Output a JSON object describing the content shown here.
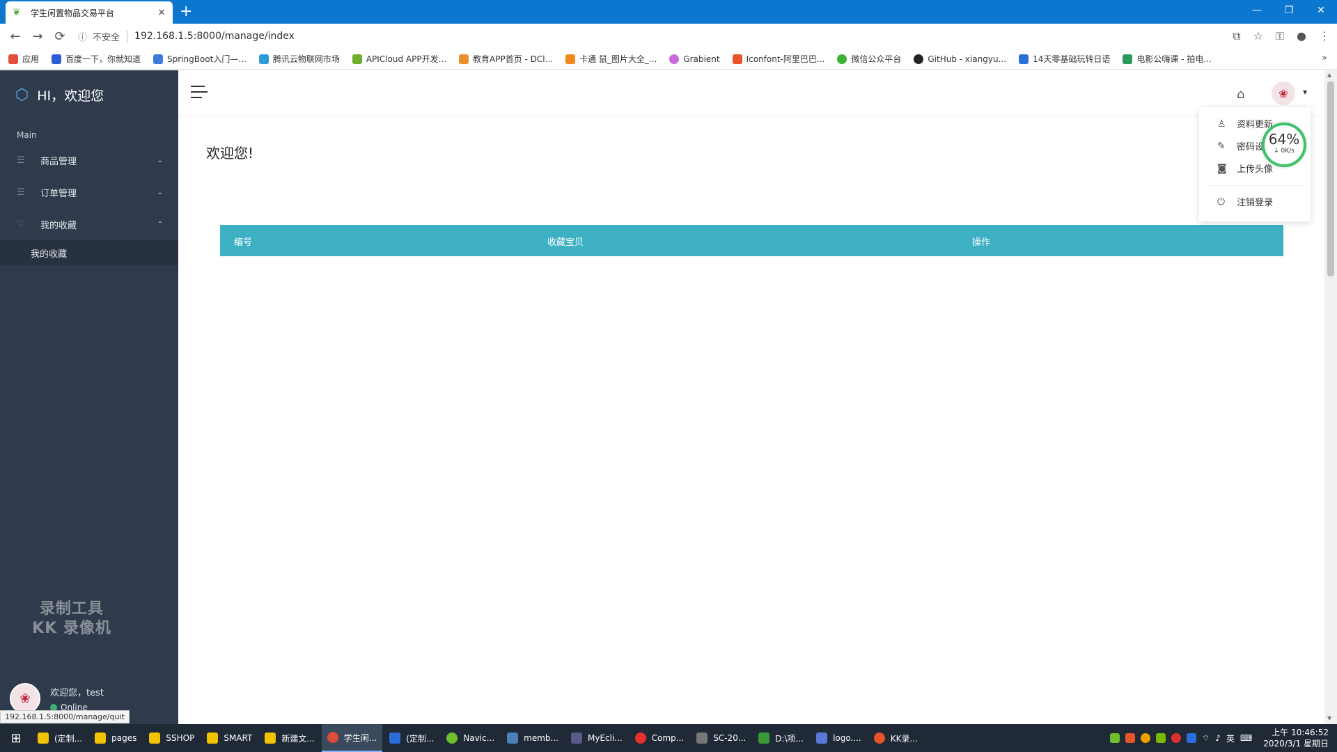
{
  "browser": {
    "tab_title": "学生闲置物品交易平台",
    "tab_close": "×",
    "new_tab": "+",
    "window_controls": {
      "minimize": "—",
      "restore": "❐",
      "close": "✕"
    },
    "nav": {
      "back": "←",
      "forward": "→",
      "reload": "⟳"
    },
    "security_label": "不安全",
    "url": "192.168.1.5:8000/manage/index",
    "bookmarks": [
      {
        "label": "应用",
        "color": "#e44d3a"
      },
      {
        "label": "百度一下，你就知道",
        "color": "#2a5dd8"
      },
      {
        "label": "SpringBoot入门—...",
        "color": "#3d7bd9"
      },
      {
        "label": "腾讯云物联网市场",
        "color": "#2b9bd9"
      },
      {
        "label": "APICloud APP开发...",
        "color": "#6fae2c"
      },
      {
        "label": "教育APP首页 - DCl...",
        "color": "#e88e2a"
      },
      {
        "label": "卡通 鼠_图片大全_...",
        "color": "#f08a1c"
      },
      {
        "label": "Grabient",
        "color": "#c86bd8"
      },
      {
        "label": "Iconfont-阿里巴巴...",
        "color": "#e8542a"
      },
      {
        "label": "微信公众平台",
        "color": "#3cb034"
      },
      {
        "label": "GitHub - xiangyu...",
        "color": "#222222"
      },
      {
        "label": "14天零基础玩转日语",
        "color": "#2a6fd8"
      },
      {
        "label": "电影公嗨课 - 拍电...",
        "color": "#2a9a5c"
      }
    ],
    "bookmarks_more": "»",
    "status_url": "192.168.1.5:8000/manage/quit"
  },
  "sidebar": {
    "brand": "HI，欢迎您",
    "section": "Main",
    "menu": [
      {
        "label": "商品管理",
        "icon": "list-icon",
        "chevron": "⌄"
      },
      {
        "label": "订单管理",
        "icon": "list-icon",
        "chevron": "⌄"
      },
      {
        "label": "我的收藏",
        "icon": "heart-icon",
        "chevron": "⌃"
      }
    ],
    "submenu": [
      {
        "label": "我的收藏"
      }
    ],
    "watermark_line1": "录制工具",
    "watermark_line2": "KK 录像机",
    "user": {
      "greeting": "欢迎您，test",
      "status": "Online"
    }
  },
  "header": {
    "dropdown": [
      {
        "label": "资料更新",
        "icon": "user-icon"
      },
      {
        "label": "密码设置",
        "icon": "edit-icon"
      },
      {
        "label": "上传头像",
        "icon": "camera-icon"
      },
      {
        "label": "注销登录",
        "icon": "power-icon"
      }
    ],
    "speed": {
      "percent": "64%",
      "rate": "↓ 0K/s"
    }
  },
  "main": {
    "welcome": "欢迎您!",
    "table_headers": [
      "编号",
      "收藏宝贝",
      "操作"
    ]
  },
  "taskbar": {
    "items": [
      {
        "label": "(定制...",
        "color": "#f2c300"
      },
      {
        "label": "pages",
        "color": "#f2c300"
      },
      {
        "label": "SSHOP",
        "color": "#f2c300"
      },
      {
        "label": "SMART",
        "color": "#f2c300"
      },
      {
        "label": "新建文...",
        "color": "#f2c300"
      },
      {
        "label": "学生闲...",
        "color": "#dd4b39"
      },
      {
        "label": "(定制...",
        "color": "#2b6dd8"
      },
      {
        "label": "Navic...",
        "color": "#6fbf2a"
      },
      {
        "label": "memb...",
        "color": "#4a7fb8"
      },
      {
        "label": "MyEcli...",
        "color": "#5a5a8a"
      },
      {
        "label": "Comp...",
        "color": "#e8302a"
      },
      {
        "label": "SC-20...",
        "color": "#777777"
      },
      {
        "label": "D:\\项...",
        "color": "#3a9a3a"
      },
      {
        "label": "logo....",
        "color": "#5a78d8"
      },
      {
        "label": "KK录...",
        "color": "#e8542a"
      }
    ],
    "tray_lang": "英",
    "time": "上午 10:46:52",
    "date": "2020/3/1 星期日"
  }
}
